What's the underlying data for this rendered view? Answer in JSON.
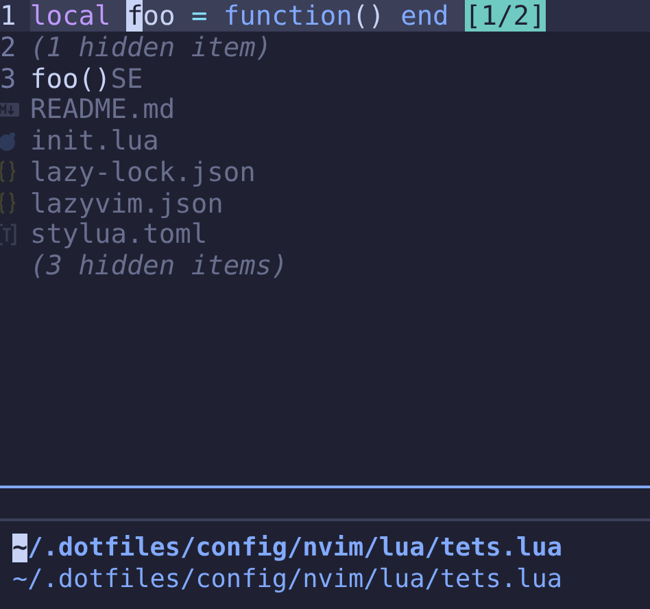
{
  "editor": {
    "lines": [
      {
        "number": "1",
        "current": true,
        "tokens": [
          {
            "text": "local ",
            "kind": "keyword"
          },
          {
            "text": "f",
            "kind": "cursor"
          },
          {
            "text": "oo ",
            "kind": "plain"
          },
          {
            "text": "= ",
            "kind": "operator"
          },
          {
            "text": "function",
            "kind": "function"
          },
          {
            "text": "() ",
            "kind": "plain"
          },
          {
            "text": "end ",
            "kind": "function"
          }
        ],
        "virtual_text": "[1/2]"
      },
      {
        "number": "2",
        "current": false,
        "ghost": {
          "text": "(1 hidden item)",
          "kind": "note"
        }
      },
      {
        "number": "3",
        "current": false,
        "tokens": [
          {
            "text": "foo()",
            "kind": "plain"
          }
        ],
        "ghost": {
          "text": "SE",
          "kind": "file"
        }
      },
      {
        "ghost": {
          "text": "README.md",
          "kind": "markdown"
        }
      },
      {
        "ghost": {
          "text": "init.lua",
          "kind": "lua"
        }
      },
      {
        "ghost": {
          "text": "lazy-lock.json",
          "kind": "json"
        }
      },
      {
        "ghost": {
          "text": "lazyvim.json",
          "kind": "json"
        }
      },
      {
        "ghost": {
          "text": "stylua.toml",
          "kind": "toml"
        }
      },
      {
        "ghost": {
          "text": "(3 hidden items)",
          "kind": "note"
        }
      }
    ]
  },
  "cmdline": {
    "rows": [
      {
        "kind": "input",
        "cursor_text": "~",
        "text": "/.dotfiles/config/nvim/lua/tets.lua"
      },
      {
        "kind": "completion",
        "text": "~/.dotfiles/config/nvim/lua/tets.lua"
      }
    ]
  }
}
